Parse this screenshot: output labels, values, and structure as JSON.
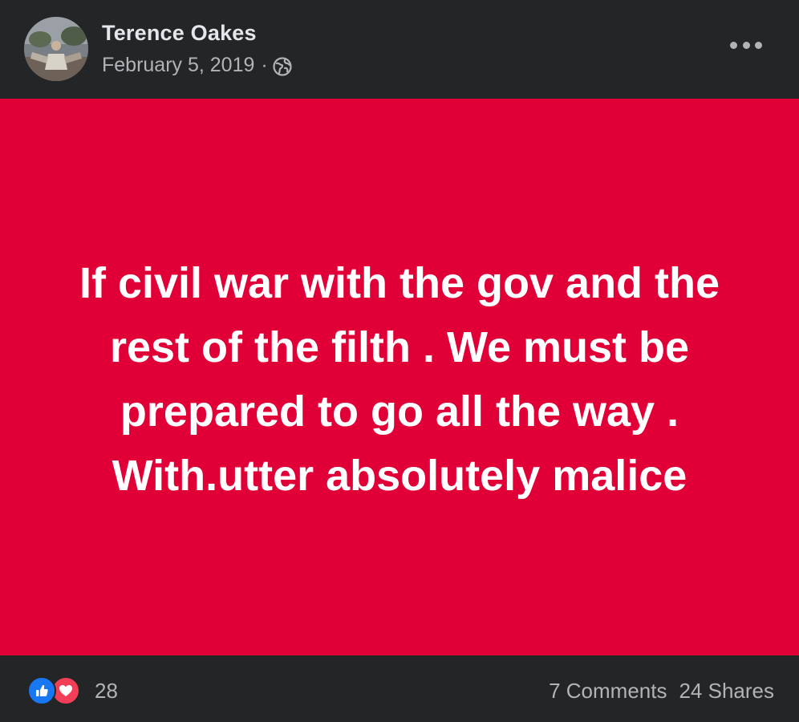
{
  "post": {
    "author": "Terence Oakes",
    "date": "February 5, 2019",
    "separator": "·",
    "privacy_icon": "globe-icon",
    "more_icon": "more-options-icon",
    "card": {
      "background": "#e00037",
      "lines": [
        "If civil war with the gov and the",
        "rest of the filth . We must be",
        "prepared to go all the way .",
        "With.utter absolutely malice"
      ]
    }
  },
  "footer": {
    "reactions": [
      "like-icon",
      "love-icon"
    ],
    "reaction_count": "28",
    "comments": "7 Comments",
    "shares": "24 Shares"
  },
  "colors": {
    "background": "#242526",
    "primary_text": "#e4e6eb",
    "secondary_text": "#b0b3b8",
    "like_blue": "#1877f2",
    "love_red": "#f33e58"
  }
}
